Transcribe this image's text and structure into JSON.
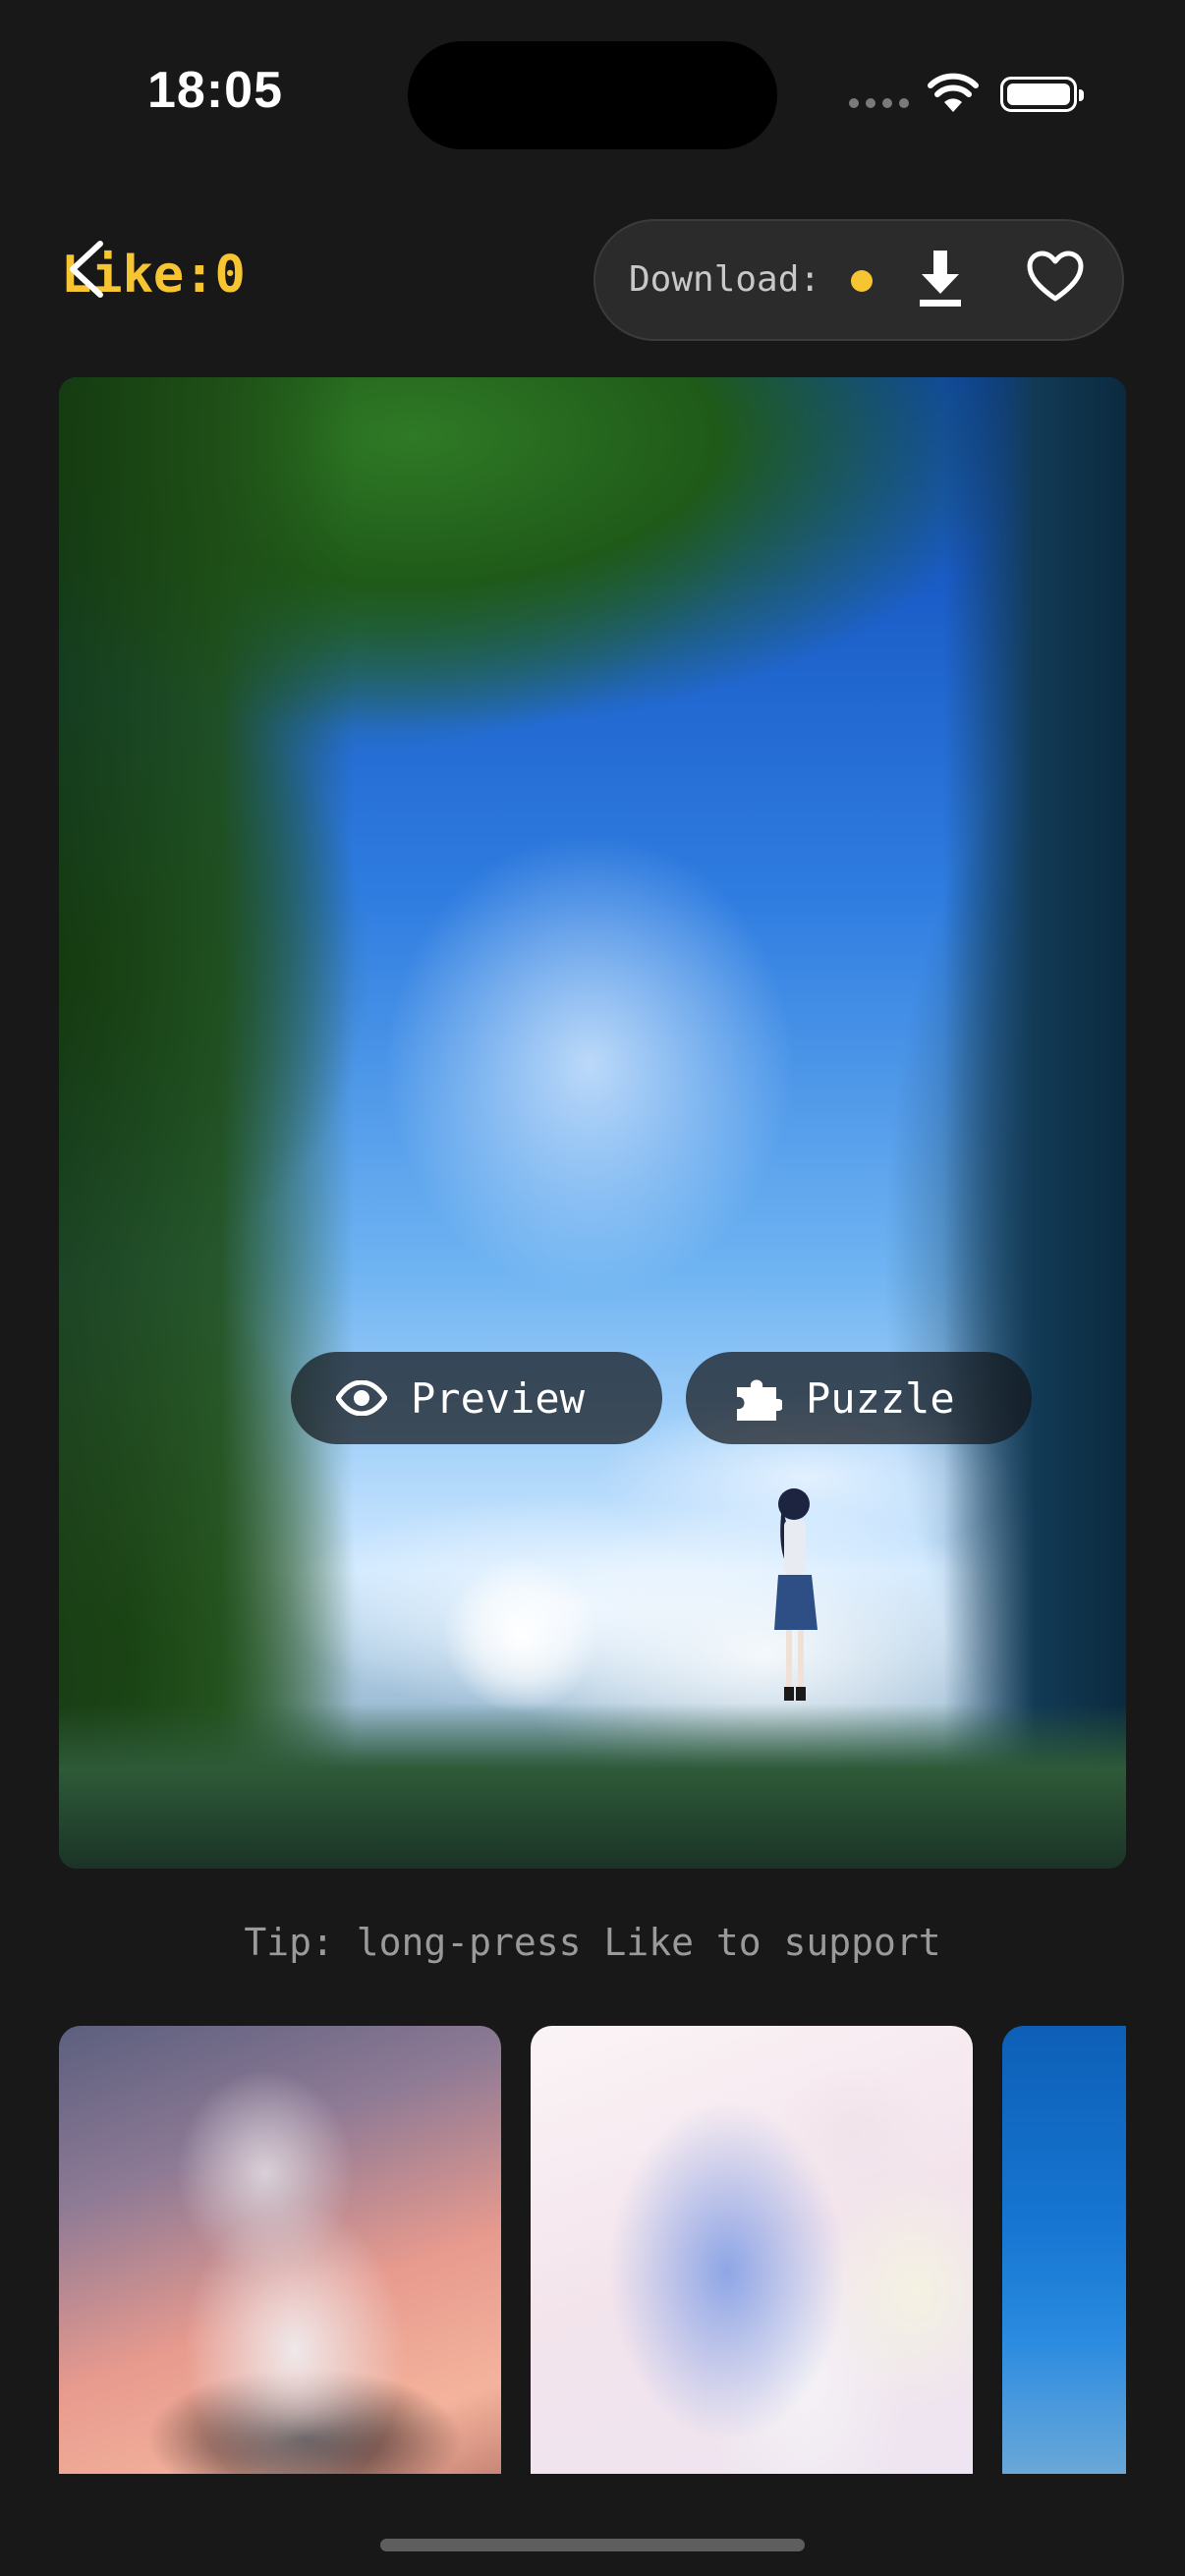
{
  "status_bar": {
    "time": "18:05"
  },
  "header": {
    "like_label": "Like:0",
    "download_label": "Download:",
    "download_dot_color": "#f6c531",
    "accent": "#f6c531"
  },
  "hero": {
    "preview_label": "Preview",
    "puzzle_label": "Puzzle"
  },
  "tip": "Tip: long-press Like to support",
  "thumbnails": [
    {
      "name": "thumb-1"
    },
    {
      "name": "thumb-2"
    },
    {
      "name": "thumb-3"
    }
  ],
  "icons": [
    "back-chevron-icon",
    "download-icon",
    "heart-icon",
    "eye-icon",
    "puzzle-icon",
    "wifi-icon",
    "battery-icon",
    "signal-icon"
  ]
}
